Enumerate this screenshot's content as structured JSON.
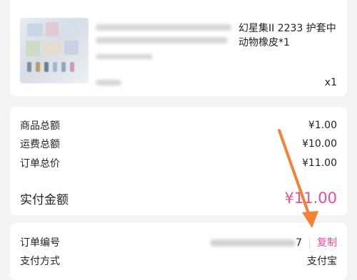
{
  "product": {
    "title_visible": "幻星集II 2233 护套中\n动物橡皮*1",
    "quantity": "x1"
  },
  "amounts": {
    "goods_total_label": "商品总额",
    "goods_total_value": "¥1.00",
    "shipping_label": "运费总额",
    "shipping_value": "¥10.00",
    "order_total_label": "订单总价",
    "order_total_value": "¥11.00",
    "paid_label": "实付金额",
    "paid_value": "¥11.00"
  },
  "order": {
    "number_label": "订单编号",
    "number_tail": "7",
    "copy_label": "复制",
    "payment_label": "支付方式",
    "payment_value": "支付宝"
  },
  "colors": {
    "accent": "#e94d97",
    "annotation_arrow": "#f5803a"
  }
}
